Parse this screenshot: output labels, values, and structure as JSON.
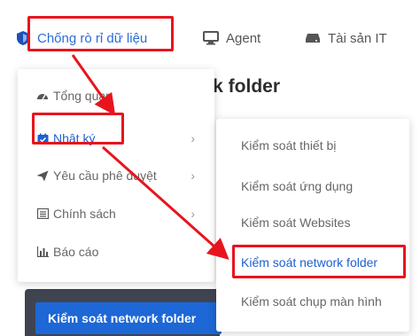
{
  "topnav": {
    "items": [
      {
        "label": "Chống rò rỉ dữ liệu",
        "icon": "shield-icon"
      },
      {
        "label": "Agent",
        "icon": "monitor-icon"
      },
      {
        "label": "Tài sản IT",
        "icon": "drive-icon"
      }
    ]
  },
  "page": {
    "heading": "rk folder"
  },
  "menu1": {
    "items": [
      {
        "label": "Tổng quan",
        "icon": "dashboard-icon"
      },
      {
        "label": "Nhật ký",
        "icon": "calendar-check-icon",
        "active": true,
        "arrow": "›"
      },
      {
        "label": "Yêu cầu phê duyệt",
        "icon": "send-icon",
        "arrow": "›"
      },
      {
        "label": "Chính sách",
        "icon": "list-icon",
        "arrow": "›"
      },
      {
        "label": "Báo cáo",
        "icon": "bar-chart-icon"
      }
    ]
  },
  "menu2": {
    "items": [
      {
        "label": "Kiểm soát thiết bị"
      },
      {
        "label": "Kiểm soát ứng dụng"
      },
      {
        "label": "Kiểm soát Websites"
      },
      {
        "label": "Kiểm soát network folder",
        "active": true
      },
      {
        "label": "Kiểm soát chụp màn hình"
      }
    ]
  },
  "lower": {
    "button_label": "Kiểm soát network folder"
  },
  "colors": {
    "accent": "#1d5fd1",
    "highlight": "#e8141d",
    "panel_dark": "#3f4450",
    "button_blue": "#1d67d6"
  }
}
